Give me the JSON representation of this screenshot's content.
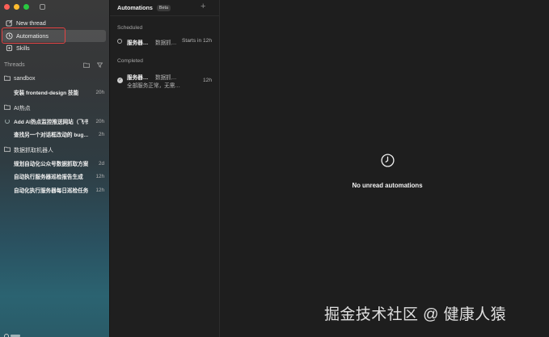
{
  "sidebar": {
    "nav": [
      {
        "label": "New thread",
        "icon": "compose-icon"
      },
      {
        "label": "Automations",
        "icon": "clock-icon",
        "active": true
      },
      {
        "label": "Skills",
        "icon": "skills-icon"
      }
    ],
    "threads_label": "Threads",
    "groups": [
      {
        "name": "sandbox",
        "threads": [
          {
            "title": "安装 frontend-design 技能",
            "time": "20h"
          }
        ]
      },
      {
        "name": "AI热点",
        "threads": [
          {
            "title": "Add AI热点监控推送网站（飞书）",
            "time": "20h",
            "running": true
          },
          {
            "title": "查找另一个对话框改动的 bug…",
            "time": "2h"
          }
        ]
      },
      {
        "name": "数据抓取机器人",
        "threads": [
          {
            "title": "规划自动化公众号数据抓取方案",
            "time": "2d"
          },
          {
            "title": "自动执行服务器巡检报告生成",
            "time": "12h"
          },
          {
            "title": "自动化执行服务器每日巡检任务",
            "time": "12h"
          }
        ]
      }
    ]
  },
  "automations": {
    "title": "Automations",
    "badge": "Beta",
    "scheduled_label": "Scheduled",
    "scheduled": [
      {
        "name": "服务器…",
        "desc": "数据抓…",
        "time": "Starts in 12h"
      }
    ],
    "completed_label": "Completed",
    "completed": [
      {
        "name": "服务器…",
        "desc": "数据抓…",
        "summary": "全部服务正常，无需…",
        "time": "12h"
      }
    ]
  },
  "main": {
    "empty_message": "No unread automations"
  },
  "watermark": "掘金技术社区 @ 健康人猿"
}
